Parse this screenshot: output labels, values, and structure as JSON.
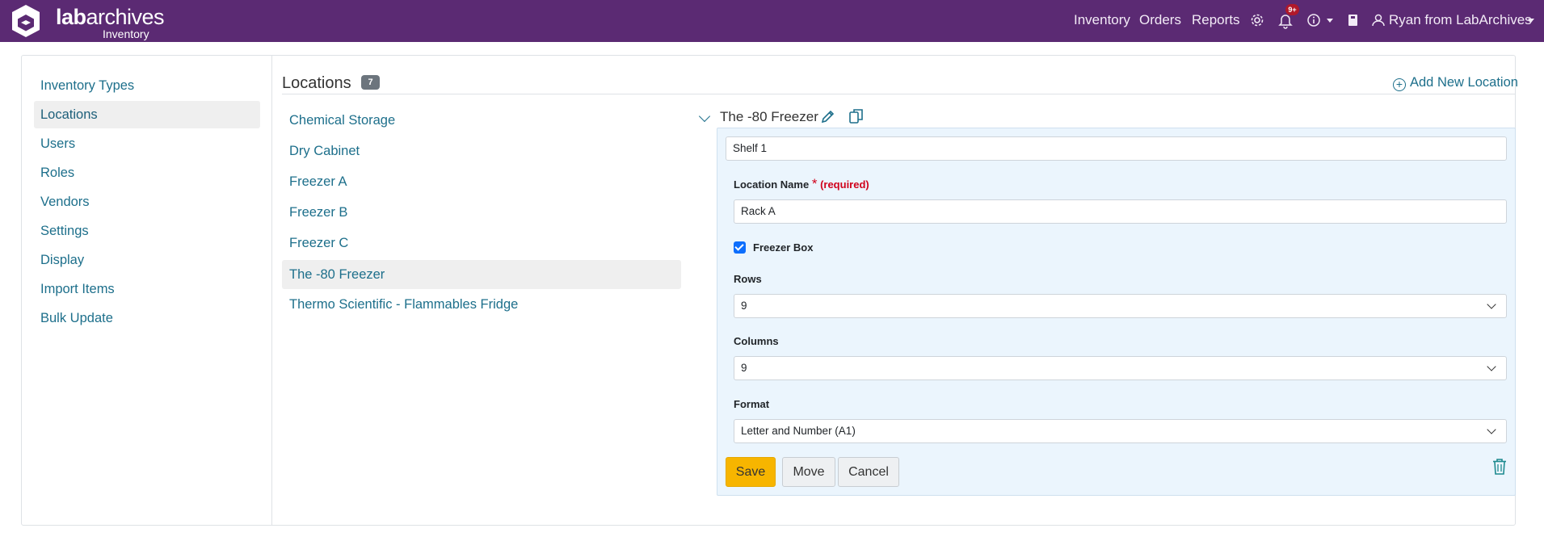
{
  "app": {
    "logo_lab": "lab",
    "logo_archives": "archives",
    "logo_sub": "Inventory"
  },
  "topnav": {
    "inventory": "Inventory",
    "orders": "Orders",
    "reports": "Reports",
    "notifications_badge": "9+",
    "user": "Ryan from LabArchives"
  },
  "sidebar": {
    "items": [
      {
        "label": "Inventory Types"
      },
      {
        "label": "Locations",
        "active": true
      },
      {
        "label": "Users"
      },
      {
        "label": "Roles"
      },
      {
        "label": "Vendors"
      },
      {
        "label": "Settings"
      },
      {
        "label": "Display"
      },
      {
        "label": "Import Items"
      },
      {
        "label": "Bulk Update"
      }
    ]
  },
  "locations": {
    "title": "Locations",
    "count": "7",
    "add_new": "Add New Location",
    "items": [
      {
        "label": "Chemical Storage"
      },
      {
        "label": "Dry Cabinet"
      },
      {
        "label": "Freezer A"
      },
      {
        "label": "Freezer B"
      },
      {
        "label": "Freezer C"
      },
      {
        "label": "The -80 Freezer",
        "active": true
      },
      {
        "label": "Thermo Scientific - Flammables Fridge"
      }
    ]
  },
  "detail": {
    "name": "The -80 Freezer",
    "parent_value": "Shelf 1",
    "location_name_label": "Location Name",
    "required_star": "*",
    "required_text": "(required)",
    "location_name_value": "Rack A",
    "freezer_box_label": "Freezer Box",
    "freezer_box_checked": true,
    "rows_label": "Rows",
    "rows_value": "9",
    "columns_label": "Columns",
    "columns_value": "9",
    "format_label": "Format",
    "format_value": "Letter and Number (A1)",
    "save": "Save",
    "move": "Move",
    "cancel": "Cancel"
  },
  "colors": {
    "header_bg": "#5b2a73",
    "link": "#1d6f8b",
    "save_button": "#f7b500",
    "panel_bg": "#ebf5fd",
    "required": "#d0021b",
    "checkbox": "#0d6efd"
  }
}
